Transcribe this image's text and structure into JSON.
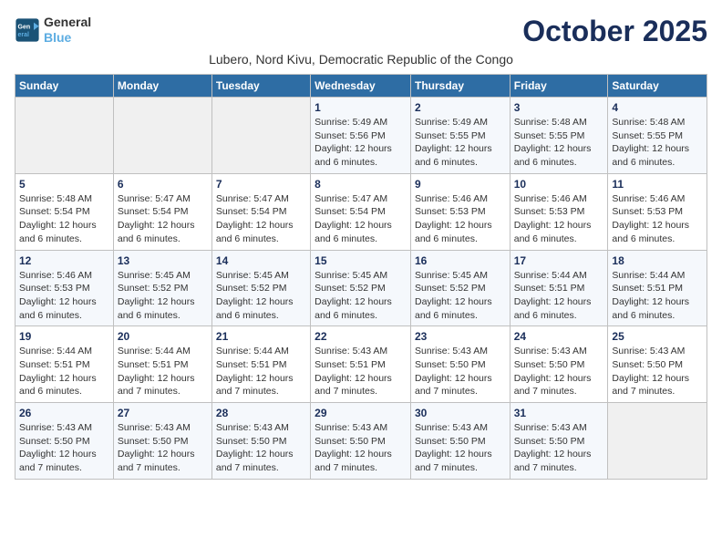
{
  "logo": {
    "line1": "General",
    "line2": "Blue"
  },
  "title": "October 2025",
  "subtitle": "Lubero, Nord Kivu, Democratic Republic of the Congo",
  "days_of_week": [
    "Sunday",
    "Monday",
    "Tuesday",
    "Wednesday",
    "Thursday",
    "Friday",
    "Saturday"
  ],
  "weeks": [
    [
      {
        "day": "",
        "info": ""
      },
      {
        "day": "",
        "info": ""
      },
      {
        "day": "",
        "info": ""
      },
      {
        "day": "1",
        "info": "Sunrise: 5:49 AM\nSunset: 5:56 PM\nDaylight: 12 hours\nand 6 minutes."
      },
      {
        "day": "2",
        "info": "Sunrise: 5:49 AM\nSunset: 5:55 PM\nDaylight: 12 hours\nand 6 minutes."
      },
      {
        "day": "3",
        "info": "Sunrise: 5:48 AM\nSunset: 5:55 PM\nDaylight: 12 hours\nand 6 minutes."
      },
      {
        "day": "4",
        "info": "Sunrise: 5:48 AM\nSunset: 5:55 PM\nDaylight: 12 hours\nand 6 minutes."
      }
    ],
    [
      {
        "day": "5",
        "info": "Sunrise: 5:48 AM\nSunset: 5:54 PM\nDaylight: 12 hours\nand 6 minutes."
      },
      {
        "day": "6",
        "info": "Sunrise: 5:47 AM\nSunset: 5:54 PM\nDaylight: 12 hours\nand 6 minutes."
      },
      {
        "day": "7",
        "info": "Sunrise: 5:47 AM\nSunset: 5:54 PM\nDaylight: 12 hours\nand 6 minutes."
      },
      {
        "day": "8",
        "info": "Sunrise: 5:47 AM\nSunset: 5:54 PM\nDaylight: 12 hours\nand 6 minutes."
      },
      {
        "day": "9",
        "info": "Sunrise: 5:46 AM\nSunset: 5:53 PM\nDaylight: 12 hours\nand 6 minutes."
      },
      {
        "day": "10",
        "info": "Sunrise: 5:46 AM\nSunset: 5:53 PM\nDaylight: 12 hours\nand 6 minutes."
      },
      {
        "day": "11",
        "info": "Sunrise: 5:46 AM\nSunset: 5:53 PM\nDaylight: 12 hours\nand 6 minutes."
      }
    ],
    [
      {
        "day": "12",
        "info": "Sunrise: 5:46 AM\nSunset: 5:53 PM\nDaylight: 12 hours\nand 6 minutes."
      },
      {
        "day": "13",
        "info": "Sunrise: 5:45 AM\nSunset: 5:52 PM\nDaylight: 12 hours\nand 6 minutes."
      },
      {
        "day": "14",
        "info": "Sunrise: 5:45 AM\nSunset: 5:52 PM\nDaylight: 12 hours\nand 6 minutes."
      },
      {
        "day": "15",
        "info": "Sunrise: 5:45 AM\nSunset: 5:52 PM\nDaylight: 12 hours\nand 6 minutes."
      },
      {
        "day": "16",
        "info": "Sunrise: 5:45 AM\nSunset: 5:52 PM\nDaylight: 12 hours\nand 6 minutes."
      },
      {
        "day": "17",
        "info": "Sunrise: 5:44 AM\nSunset: 5:51 PM\nDaylight: 12 hours\nand 6 minutes."
      },
      {
        "day": "18",
        "info": "Sunrise: 5:44 AM\nSunset: 5:51 PM\nDaylight: 12 hours\nand 6 minutes."
      }
    ],
    [
      {
        "day": "19",
        "info": "Sunrise: 5:44 AM\nSunset: 5:51 PM\nDaylight: 12 hours\nand 6 minutes."
      },
      {
        "day": "20",
        "info": "Sunrise: 5:44 AM\nSunset: 5:51 PM\nDaylight: 12 hours\nand 7 minutes."
      },
      {
        "day": "21",
        "info": "Sunrise: 5:44 AM\nSunset: 5:51 PM\nDaylight: 12 hours\nand 7 minutes."
      },
      {
        "day": "22",
        "info": "Sunrise: 5:43 AM\nSunset: 5:51 PM\nDaylight: 12 hours\nand 7 minutes."
      },
      {
        "day": "23",
        "info": "Sunrise: 5:43 AM\nSunset: 5:50 PM\nDaylight: 12 hours\nand 7 minutes."
      },
      {
        "day": "24",
        "info": "Sunrise: 5:43 AM\nSunset: 5:50 PM\nDaylight: 12 hours\nand 7 minutes."
      },
      {
        "day": "25",
        "info": "Sunrise: 5:43 AM\nSunset: 5:50 PM\nDaylight: 12 hours\nand 7 minutes."
      }
    ],
    [
      {
        "day": "26",
        "info": "Sunrise: 5:43 AM\nSunset: 5:50 PM\nDaylight: 12 hours\nand 7 minutes."
      },
      {
        "day": "27",
        "info": "Sunrise: 5:43 AM\nSunset: 5:50 PM\nDaylight: 12 hours\nand 7 minutes."
      },
      {
        "day": "28",
        "info": "Sunrise: 5:43 AM\nSunset: 5:50 PM\nDaylight: 12 hours\nand 7 minutes."
      },
      {
        "day": "29",
        "info": "Sunrise: 5:43 AM\nSunset: 5:50 PM\nDaylight: 12 hours\nand 7 minutes."
      },
      {
        "day": "30",
        "info": "Sunrise: 5:43 AM\nSunset: 5:50 PM\nDaylight: 12 hours\nand 7 minutes."
      },
      {
        "day": "31",
        "info": "Sunrise: 5:43 AM\nSunset: 5:50 PM\nDaylight: 12 hours\nand 7 minutes."
      },
      {
        "day": "",
        "info": ""
      }
    ]
  ]
}
